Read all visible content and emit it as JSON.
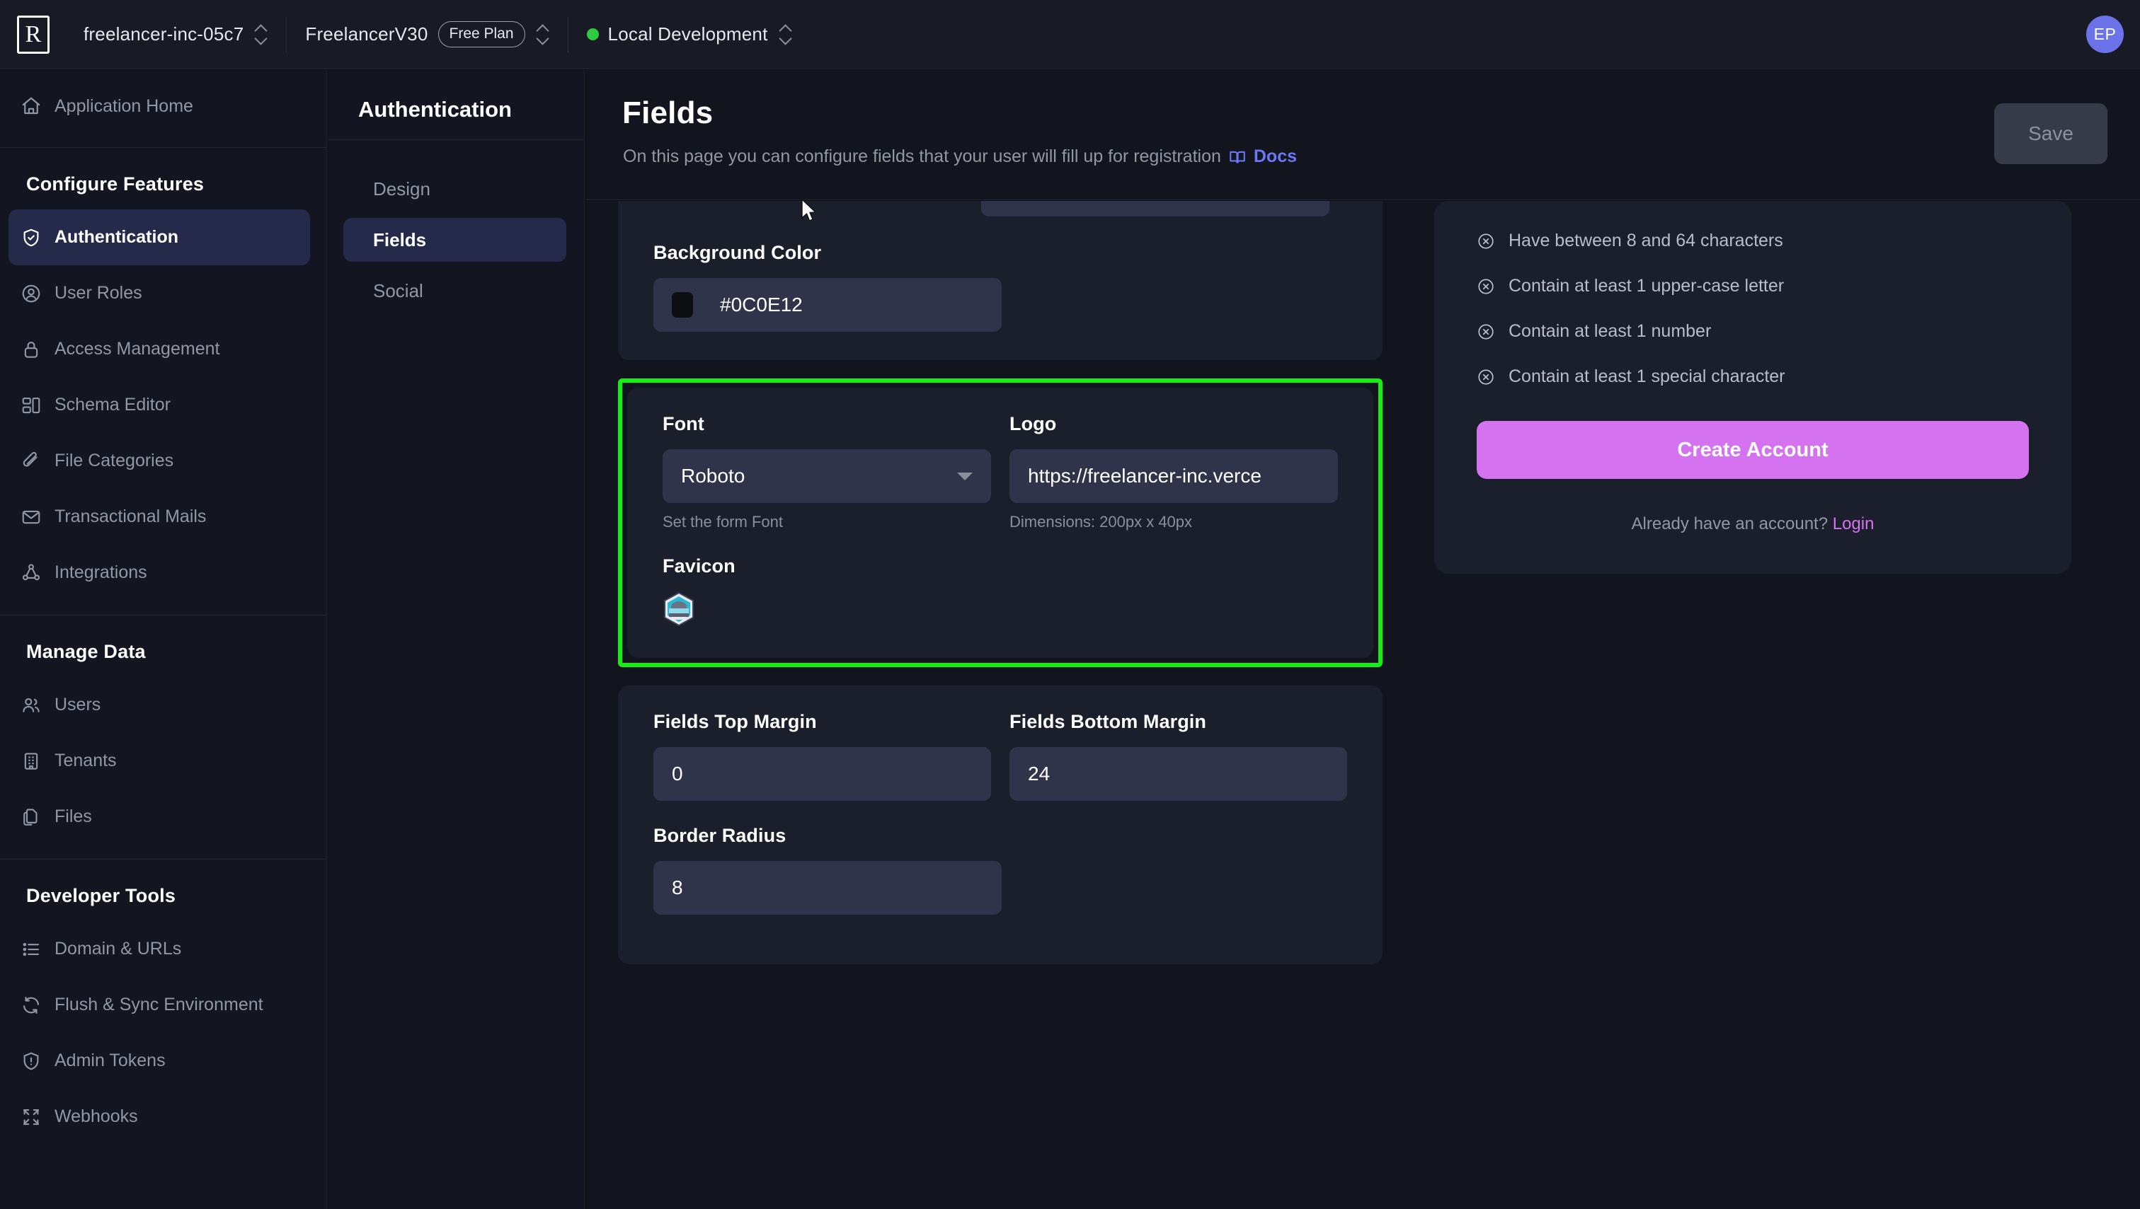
{
  "topbar": {
    "logo": "R",
    "org": "freelancer-inc-05c7",
    "project": "FreelancerV30",
    "plan_badge": "Free Plan",
    "environment": "Local Development",
    "env_dot_color": "#2ecc40",
    "avatar_initials": "EP"
  },
  "sidebar": {
    "home": {
      "label": "Application Home",
      "icon": "home-icon"
    },
    "groups": [
      {
        "title": "Configure Features",
        "items": [
          {
            "label": "Authentication",
            "icon": "shield-check-icon",
            "active": true
          },
          {
            "label": "User Roles",
            "icon": "user-circle-icon",
            "active": false
          },
          {
            "label": "Access Management",
            "icon": "lock-icon",
            "active": false
          },
          {
            "label": "Schema Editor",
            "icon": "schema-icon",
            "active": false
          },
          {
            "label": "File Categories",
            "icon": "paperclip-icon",
            "active": false
          },
          {
            "label": "Transactional Mails",
            "icon": "mail-icon",
            "active": false
          },
          {
            "label": "Integrations",
            "icon": "integrations-icon",
            "active": false
          }
        ]
      },
      {
        "title": "Manage Data",
        "items": [
          {
            "label": "Users",
            "icon": "users-icon",
            "active": false
          },
          {
            "label": "Tenants",
            "icon": "building-icon",
            "active": false
          },
          {
            "label": "Files",
            "icon": "files-icon",
            "active": false
          }
        ]
      },
      {
        "title": "Developer Tools",
        "items": [
          {
            "label": "Domain & URLs",
            "icon": "list-icon",
            "active": false
          },
          {
            "label": "Flush & Sync Environment",
            "icon": "refresh-icon",
            "active": false
          },
          {
            "label": "Admin Tokens",
            "icon": "shield-alert-icon",
            "active": false
          },
          {
            "label": "Webhooks",
            "icon": "webhook-icon",
            "active": false
          }
        ]
      }
    ]
  },
  "subnav": {
    "heading": "Authentication",
    "items": [
      {
        "label": "Design",
        "active": false
      },
      {
        "label": "Fields",
        "active": true
      },
      {
        "label": "Social",
        "active": false
      }
    ]
  },
  "header": {
    "title": "Fields",
    "subtitle": "On this page you can configure fields that your user will fill up for registration",
    "docs_label": "Docs",
    "docs_icon": "book-icon",
    "save_label": "Save"
  },
  "main": {
    "background_color": {
      "label": "Background Color",
      "value": "#0C0E12",
      "swatch": "#0c0e12"
    },
    "highlighted_card": {
      "highlight_color": "#14f014",
      "font": {
        "label": "Font",
        "value": "Roboto",
        "helper": "Set the form Font",
        "icon": "chevron-down-icon"
      },
      "logo": {
        "label": "Logo",
        "value": "https://freelancer-inc.verce",
        "helper": "Dimensions: 200px x 40px"
      },
      "favicon": {
        "label": "Favicon",
        "icon": "favicon-hex-badge"
      }
    },
    "spacing_card": {
      "fields_top_margin": {
        "label": "Fields Top Margin",
        "value": "0"
      },
      "fields_bottom_margin": {
        "label": "Fields Bottom Margin",
        "value": "24"
      },
      "border_radius": {
        "label": "Border Radius",
        "value": "8"
      }
    }
  },
  "preview": {
    "requirements": [
      {
        "text": "Have between 8 and 64 characters",
        "icon": "circle-x-icon"
      },
      {
        "text": "Contain at least 1 upper-case letter",
        "icon": "circle-x-icon"
      },
      {
        "text": "Contain at least 1 number",
        "icon": "circle-x-icon"
      },
      {
        "text": "Contain at least 1 special character",
        "icon": "circle-x-icon"
      }
    ],
    "cta_label": "Create Account",
    "cta_color": "#d572f0",
    "alt_text": "Already have an account?",
    "alt_link": "Login"
  }
}
